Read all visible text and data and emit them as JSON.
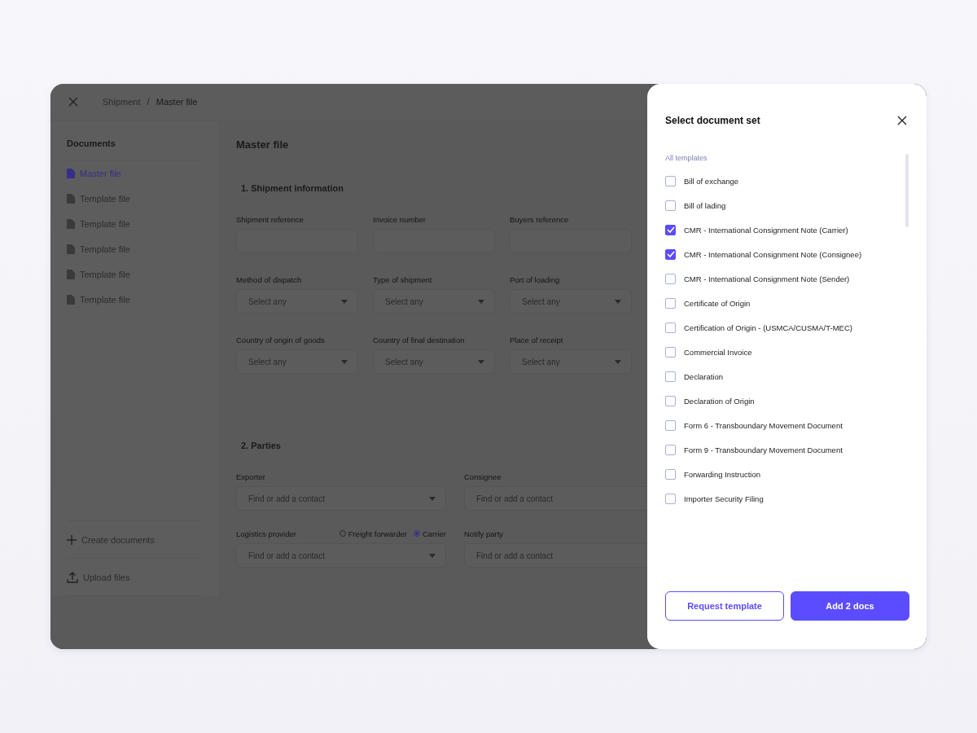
{
  "breadcrumb": {
    "items": [
      "Shipment",
      "Master file"
    ],
    "separator": "/"
  },
  "sidebar": {
    "title": "Documents",
    "items": [
      {
        "label": "Master file",
        "selected": true
      },
      {
        "label": "Template file",
        "selected": false
      },
      {
        "label": "Template file",
        "selected": false
      },
      {
        "label": "Template file",
        "selected": false
      },
      {
        "label": "Template file",
        "selected": false
      },
      {
        "label": "Template file",
        "selected": false
      }
    ],
    "actions": [
      {
        "kind": "create",
        "label": "Create documents"
      },
      {
        "kind": "upload",
        "label": "Upload files"
      }
    ]
  },
  "main": {
    "title": "Master file",
    "sections": [
      {
        "title": "1. Shipment information",
        "kind": "grid",
        "fields": [
          {
            "label": "Shipment reference",
            "kind": "text"
          },
          {
            "label": "Invoice number",
            "kind": "text"
          },
          {
            "label": "Buyers reference",
            "kind": "text"
          },
          {
            "label": "Method of dispatch",
            "kind": "select",
            "placeholder": "Select any"
          },
          {
            "label": "Type of shipment",
            "kind": "select",
            "placeholder": "Select any"
          },
          {
            "label": "Port of loading",
            "kind": "select",
            "placeholder": "Select any"
          },
          {
            "label": "Country of origin of goods",
            "kind": "select",
            "placeholder": "Select any"
          },
          {
            "label": "Country of final destination",
            "kind": "select",
            "placeholder": "Select any"
          },
          {
            "label": "Place of receipt",
            "kind": "select",
            "placeholder": "Select any"
          }
        ]
      },
      {
        "title": "2. Parties",
        "kind": "wide",
        "fields": [
          {
            "label": "Exporter",
            "kind": "select",
            "placeholder": "Find or add a contact"
          },
          {
            "label": "Consignee",
            "kind": "search",
            "placeholder": "Find or add a contact"
          },
          {
            "label": "Logistics provider",
            "kind": "select",
            "placeholder": "Find or add a contact",
            "options": [
              {
                "label": "Freight forwarder",
                "selected": false
              },
              {
                "label": "Carrier",
                "selected": true
              }
            ]
          },
          {
            "label": "Notify party",
            "kind": "search",
            "placeholder": "Find or add a contact"
          }
        ]
      }
    ]
  },
  "drawer": {
    "title": "Select document set",
    "group_label": "All templates",
    "items": [
      {
        "label": "Bill of exchange",
        "checked": false
      },
      {
        "label": "Bill of lading",
        "checked": false
      },
      {
        "label": "CMR - International Consignment Note (Carrier)",
        "checked": true
      },
      {
        "label": "CMR - International Consignment Note (Consignee)",
        "checked": true
      },
      {
        "label": "CMR - International Consignment Note (Sender)",
        "checked": false
      },
      {
        "label": "Certificate of Origin",
        "checked": false
      },
      {
        "label": "Certification of Origin - (USMCA/CUSMA/T-MEC)",
        "checked": false
      },
      {
        "label": "Commercial Invoice",
        "checked": false
      },
      {
        "label": "Declaration",
        "checked": false
      },
      {
        "label": "Declaration of Origin",
        "checked": false
      },
      {
        "label": "Form 6 - Transboundary Movement Document",
        "checked": false
      },
      {
        "label": "Form 9 - Transboundary Movement Document",
        "checked": false
      },
      {
        "label": "Forwarding Instruction",
        "checked": false
      },
      {
        "label": "Importer Security Filing",
        "checked": false
      }
    ],
    "buttons": [
      {
        "kind": "secondary",
        "label": "Request template"
      },
      {
        "kind": "primary",
        "label": "Add 2 docs"
      }
    ]
  }
}
